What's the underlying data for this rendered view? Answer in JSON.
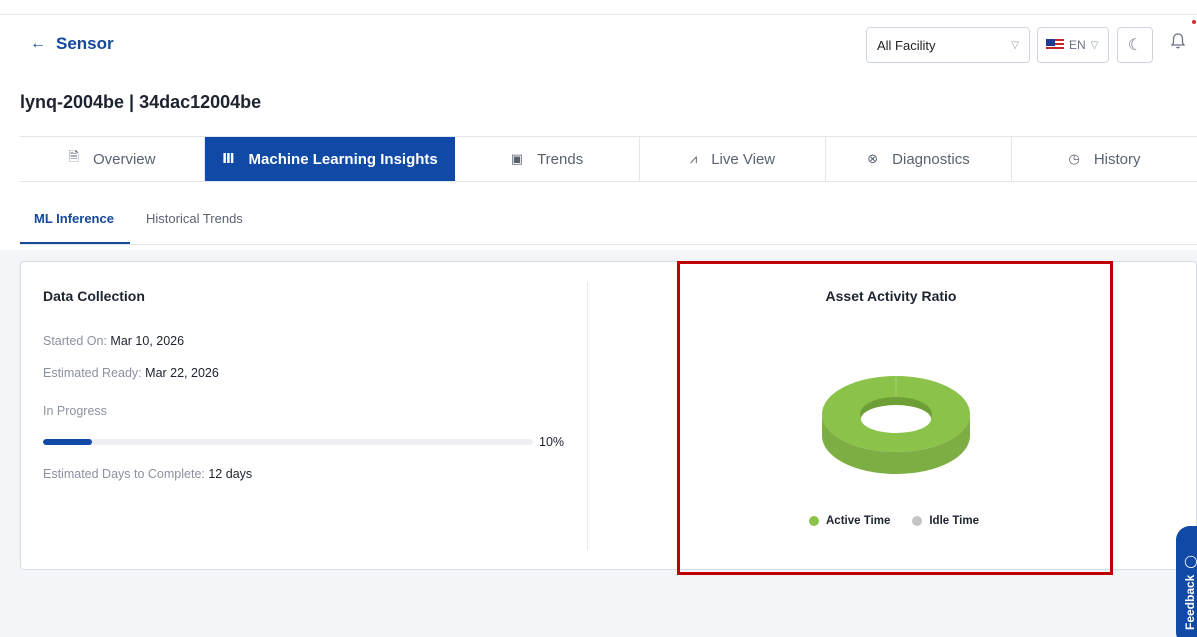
{
  "header": {
    "back_label": "Sensor",
    "facility_select": "All Facility",
    "language": "EN"
  },
  "device": {
    "title": "lynq-2004be | 34dac12004be"
  },
  "tabs": [
    {
      "label": "Overview",
      "icon": "document-icon",
      "active": false
    },
    {
      "label": "Machine Learning Insights",
      "icon": "library-icon",
      "active": true
    },
    {
      "label": "Trends",
      "icon": "trend-doc-icon",
      "active": false
    },
    {
      "label": "Live View",
      "icon": "chart-line-icon",
      "active": false
    },
    {
      "label": "Diagnostics",
      "icon": "diagnostics-icon",
      "active": false
    },
    {
      "label": "History",
      "icon": "history-icon",
      "active": false
    }
  ],
  "subtabs": [
    {
      "label": "ML Inference",
      "active": true
    },
    {
      "label": "Historical Trends",
      "active": false
    }
  ],
  "data_collection": {
    "title": "Data Collection",
    "started_label": "Started On:",
    "started_value": "Mar 10, 2026",
    "ready_label": "Estimated Ready:",
    "ready_value": "Mar 22, 2026",
    "status": "In Progress",
    "progress": 0.1,
    "progress_label": "10%",
    "days_label": "Estimated Days to Complete:",
    "days_value": "12 days"
  },
  "activity_chart": {
    "title": "Asset Activity Ratio",
    "legend": [
      {
        "label": "Active Time",
        "color": "#8bc34a"
      },
      {
        "label": "Idle Time",
        "color": "#c4c4c4"
      }
    ]
  },
  "chart_data": {
    "type": "pie",
    "title": "Asset Activity Ratio",
    "categories": [
      "Active Time",
      "Idle Time"
    ],
    "values": [
      100,
      0
    ],
    "colors": [
      "#8bc34a",
      "#c4c4c4"
    ]
  },
  "feedback_label": "Feedback",
  "colors": {
    "primary": "#1149a6",
    "highlight": "#c00000"
  }
}
